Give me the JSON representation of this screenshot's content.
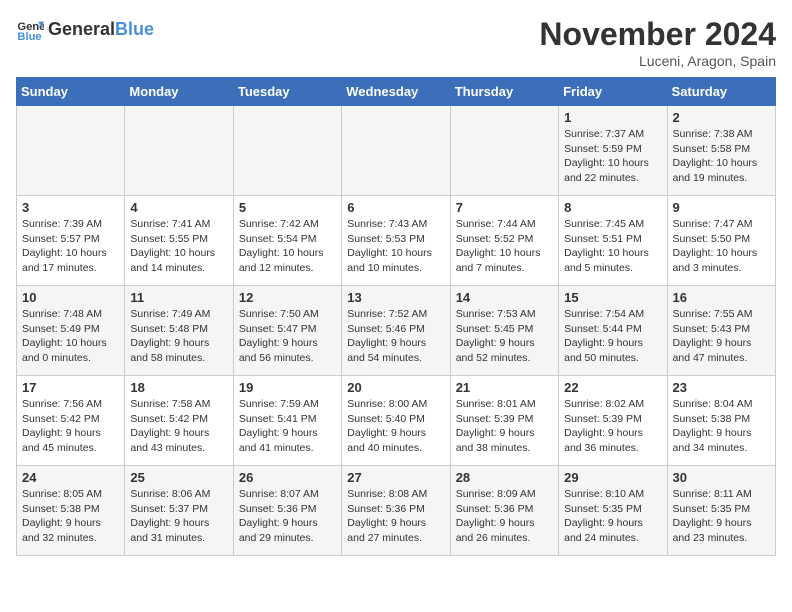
{
  "header": {
    "logo_general": "General",
    "logo_blue": "Blue",
    "title": "November 2024",
    "location": "Luceni, Aragon, Spain"
  },
  "days_of_week": [
    "Sunday",
    "Monday",
    "Tuesday",
    "Wednesday",
    "Thursday",
    "Friday",
    "Saturday"
  ],
  "weeks": [
    [
      {
        "day": "",
        "info": ""
      },
      {
        "day": "",
        "info": ""
      },
      {
        "day": "",
        "info": ""
      },
      {
        "day": "",
        "info": ""
      },
      {
        "day": "",
        "info": ""
      },
      {
        "day": "1",
        "info": "Sunrise: 7:37 AM\nSunset: 5:59 PM\nDaylight: 10 hours and 22 minutes."
      },
      {
        "day": "2",
        "info": "Sunrise: 7:38 AM\nSunset: 5:58 PM\nDaylight: 10 hours and 19 minutes."
      }
    ],
    [
      {
        "day": "3",
        "info": "Sunrise: 7:39 AM\nSunset: 5:57 PM\nDaylight: 10 hours and 17 minutes."
      },
      {
        "day": "4",
        "info": "Sunrise: 7:41 AM\nSunset: 5:55 PM\nDaylight: 10 hours and 14 minutes."
      },
      {
        "day": "5",
        "info": "Sunrise: 7:42 AM\nSunset: 5:54 PM\nDaylight: 10 hours and 12 minutes."
      },
      {
        "day": "6",
        "info": "Sunrise: 7:43 AM\nSunset: 5:53 PM\nDaylight: 10 hours and 10 minutes."
      },
      {
        "day": "7",
        "info": "Sunrise: 7:44 AM\nSunset: 5:52 PM\nDaylight: 10 hours and 7 minutes."
      },
      {
        "day": "8",
        "info": "Sunrise: 7:45 AM\nSunset: 5:51 PM\nDaylight: 10 hours and 5 minutes."
      },
      {
        "day": "9",
        "info": "Sunrise: 7:47 AM\nSunset: 5:50 PM\nDaylight: 10 hours and 3 minutes."
      }
    ],
    [
      {
        "day": "10",
        "info": "Sunrise: 7:48 AM\nSunset: 5:49 PM\nDaylight: 10 hours and 0 minutes."
      },
      {
        "day": "11",
        "info": "Sunrise: 7:49 AM\nSunset: 5:48 PM\nDaylight: 9 hours and 58 minutes."
      },
      {
        "day": "12",
        "info": "Sunrise: 7:50 AM\nSunset: 5:47 PM\nDaylight: 9 hours and 56 minutes."
      },
      {
        "day": "13",
        "info": "Sunrise: 7:52 AM\nSunset: 5:46 PM\nDaylight: 9 hours and 54 minutes."
      },
      {
        "day": "14",
        "info": "Sunrise: 7:53 AM\nSunset: 5:45 PM\nDaylight: 9 hours and 52 minutes."
      },
      {
        "day": "15",
        "info": "Sunrise: 7:54 AM\nSunset: 5:44 PM\nDaylight: 9 hours and 50 minutes."
      },
      {
        "day": "16",
        "info": "Sunrise: 7:55 AM\nSunset: 5:43 PM\nDaylight: 9 hours and 47 minutes."
      }
    ],
    [
      {
        "day": "17",
        "info": "Sunrise: 7:56 AM\nSunset: 5:42 PM\nDaylight: 9 hours and 45 minutes."
      },
      {
        "day": "18",
        "info": "Sunrise: 7:58 AM\nSunset: 5:42 PM\nDaylight: 9 hours and 43 minutes."
      },
      {
        "day": "19",
        "info": "Sunrise: 7:59 AM\nSunset: 5:41 PM\nDaylight: 9 hours and 41 minutes."
      },
      {
        "day": "20",
        "info": "Sunrise: 8:00 AM\nSunset: 5:40 PM\nDaylight: 9 hours and 40 minutes."
      },
      {
        "day": "21",
        "info": "Sunrise: 8:01 AM\nSunset: 5:39 PM\nDaylight: 9 hours and 38 minutes."
      },
      {
        "day": "22",
        "info": "Sunrise: 8:02 AM\nSunset: 5:39 PM\nDaylight: 9 hours and 36 minutes."
      },
      {
        "day": "23",
        "info": "Sunrise: 8:04 AM\nSunset: 5:38 PM\nDaylight: 9 hours and 34 minutes."
      }
    ],
    [
      {
        "day": "24",
        "info": "Sunrise: 8:05 AM\nSunset: 5:38 PM\nDaylight: 9 hours and 32 minutes."
      },
      {
        "day": "25",
        "info": "Sunrise: 8:06 AM\nSunset: 5:37 PM\nDaylight: 9 hours and 31 minutes."
      },
      {
        "day": "26",
        "info": "Sunrise: 8:07 AM\nSunset: 5:36 PM\nDaylight: 9 hours and 29 minutes."
      },
      {
        "day": "27",
        "info": "Sunrise: 8:08 AM\nSunset: 5:36 PM\nDaylight: 9 hours and 27 minutes."
      },
      {
        "day": "28",
        "info": "Sunrise: 8:09 AM\nSunset: 5:36 PM\nDaylight: 9 hours and 26 minutes."
      },
      {
        "day": "29",
        "info": "Sunrise: 8:10 AM\nSunset: 5:35 PM\nDaylight: 9 hours and 24 minutes."
      },
      {
        "day": "30",
        "info": "Sunrise: 8:11 AM\nSunset: 5:35 PM\nDaylight: 9 hours and 23 minutes."
      }
    ]
  ]
}
